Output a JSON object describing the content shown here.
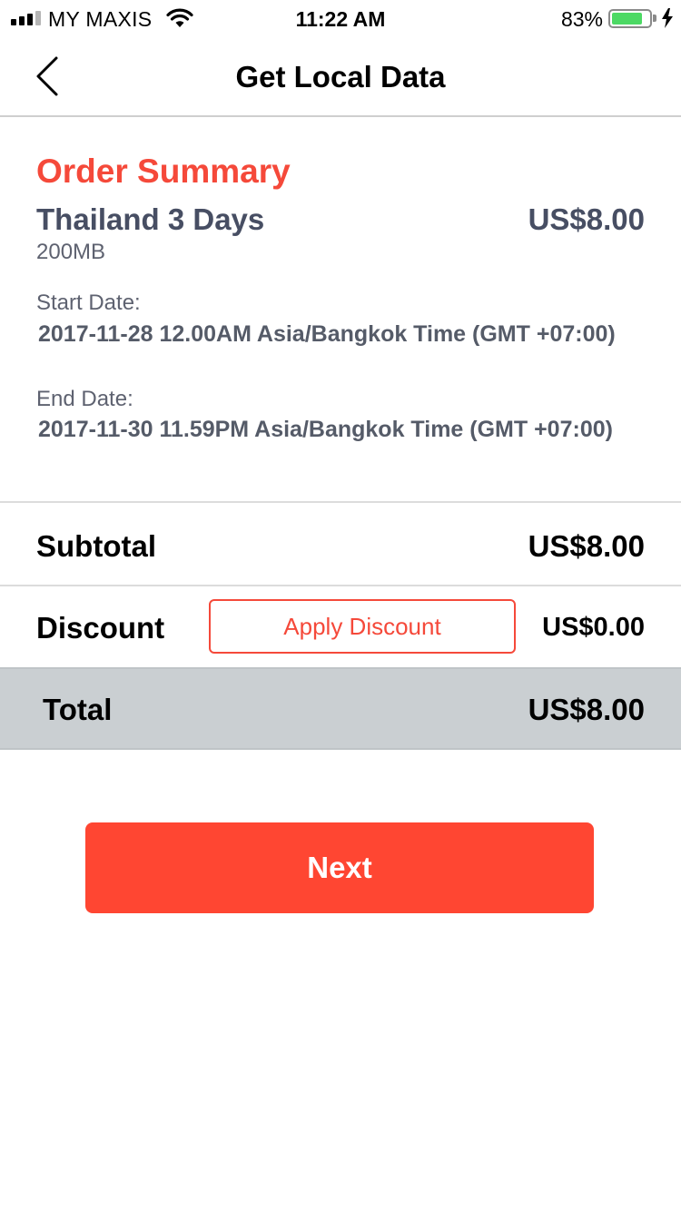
{
  "status_bar": {
    "carrier": "MY MAXIS",
    "time": "11:22 AM",
    "battery_percent": "83%",
    "battery_level": 0.83,
    "icons": [
      "signal-icon",
      "wifi-icon",
      "battery-icon",
      "charging-icon"
    ],
    "battery_color": "#4cd964"
  },
  "nav": {
    "title": "Get Local Data",
    "back_icon": "chevron-left-icon"
  },
  "order": {
    "heading": "Order Summary",
    "plan_name": "Thailand 3 Days",
    "plan_price": "US$8.00",
    "plan_data": "200MB",
    "start_label": "Start Date:",
    "start_value": "2017-11-28 12.00AM Asia/Bangkok Time (GMT +07:00)",
    "end_label": "End Date:",
    "end_value": "2017-11-30 11.59PM Asia/Bangkok Time (GMT +07:00)"
  },
  "subtotal": {
    "label": "Subtotal",
    "value": "US$8.00"
  },
  "discount": {
    "label": "Discount",
    "button_label": "Apply Discount",
    "value": "US$0.00"
  },
  "total": {
    "label": "Total",
    "value": "US$8.00"
  },
  "next_button": {
    "label": "Next"
  },
  "colors": {
    "accent": "#f5493a",
    "next_button": "#ff4632",
    "total_bar": "#cacfd2",
    "plan_text": "#474e63"
  }
}
